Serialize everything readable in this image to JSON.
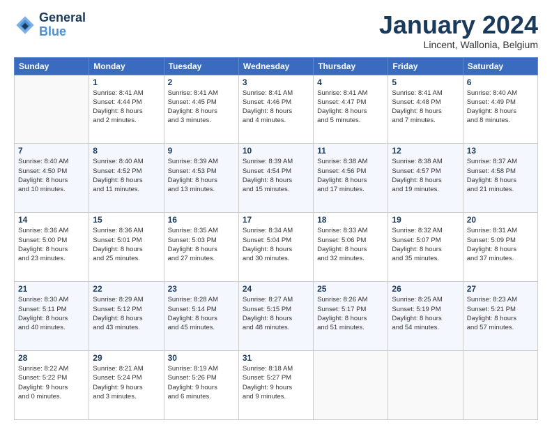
{
  "header": {
    "logo_line1": "General",
    "logo_line2": "Blue",
    "title": "January 2024",
    "subtitle": "Lincent, Wallonia, Belgium"
  },
  "days_of_week": [
    "Sunday",
    "Monday",
    "Tuesday",
    "Wednesday",
    "Thursday",
    "Friday",
    "Saturday"
  ],
  "weeks": [
    [
      {
        "day": "",
        "detail": ""
      },
      {
        "day": "1",
        "detail": "Sunrise: 8:41 AM\nSunset: 4:44 PM\nDaylight: 8 hours\nand 2 minutes."
      },
      {
        "day": "2",
        "detail": "Sunrise: 8:41 AM\nSunset: 4:45 PM\nDaylight: 8 hours\nand 3 minutes."
      },
      {
        "day": "3",
        "detail": "Sunrise: 8:41 AM\nSunset: 4:46 PM\nDaylight: 8 hours\nand 4 minutes."
      },
      {
        "day": "4",
        "detail": "Sunrise: 8:41 AM\nSunset: 4:47 PM\nDaylight: 8 hours\nand 5 minutes."
      },
      {
        "day": "5",
        "detail": "Sunrise: 8:41 AM\nSunset: 4:48 PM\nDaylight: 8 hours\nand 7 minutes."
      },
      {
        "day": "6",
        "detail": "Sunrise: 8:40 AM\nSunset: 4:49 PM\nDaylight: 8 hours\nand 8 minutes."
      }
    ],
    [
      {
        "day": "7",
        "detail": "Sunrise: 8:40 AM\nSunset: 4:50 PM\nDaylight: 8 hours\nand 10 minutes."
      },
      {
        "day": "8",
        "detail": "Sunrise: 8:40 AM\nSunset: 4:52 PM\nDaylight: 8 hours\nand 11 minutes."
      },
      {
        "day": "9",
        "detail": "Sunrise: 8:39 AM\nSunset: 4:53 PM\nDaylight: 8 hours\nand 13 minutes."
      },
      {
        "day": "10",
        "detail": "Sunrise: 8:39 AM\nSunset: 4:54 PM\nDaylight: 8 hours\nand 15 minutes."
      },
      {
        "day": "11",
        "detail": "Sunrise: 8:38 AM\nSunset: 4:56 PM\nDaylight: 8 hours\nand 17 minutes."
      },
      {
        "day": "12",
        "detail": "Sunrise: 8:38 AM\nSunset: 4:57 PM\nDaylight: 8 hours\nand 19 minutes."
      },
      {
        "day": "13",
        "detail": "Sunrise: 8:37 AM\nSunset: 4:58 PM\nDaylight: 8 hours\nand 21 minutes."
      }
    ],
    [
      {
        "day": "14",
        "detail": "Sunrise: 8:36 AM\nSunset: 5:00 PM\nDaylight: 8 hours\nand 23 minutes."
      },
      {
        "day": "15",
        "detail": "Sunrise: 8:36 AM\nSunset: 5:01 PM\nDaylight: 8 hours\nand 25 minutes."
      },
      {
        "day": "16",
        "detail": "Sunrise: 8:35 AM\nSunset: 5:03 PM\nDaylight: 8 hours\nand 27 minutes."
      },
      {
        "day": "17",
        "detail": "Sunrise: 8:34 AM\nSunset: 5:04 PM\nDaylight: 8 hours\nand 30 minutes."
      },
      {
        "day": "18",
        "detail": "Sunrise: 8:33 AM\nSunset: 5:06 PM\nDaylight: 8 hours\nand 32 minutes."
      },
      {
        "day": "19",
        "detail": "Sunrise: 8:32 AM\nSunset: 5:07 PM\nDaylight: 8 hours\nand 35 minutes."
      },
      {
        "day": "20",
        "detail": "Sunrise: 8:31 AM\nSunset: 5:09 PM\nDaylight: 8 hours\nand 37 minutes."
      }
    ],
    [
      {
        "day": "21",
        "detail": "Sunrise: 8:30 AM\nSunset: 5:11 PM\nDaylight: 8 hours\nand 40 minutes."
      },
      {
        "day": "22",
        "detail": "Sunrise: 8:29 AM\nSunset: 5:12 PM\nDaylight: 8 hours\nand 43 minutes."
      },
      {
        "day": "23",
        "detail": "Sunrise: 8:28 AM\nSunset: 5:14 PM\nDaylight: 8 hours\nand 45 minutes."
      },
      {
        "day": "24",
        "detail": "Sunrise: 8:27 AM\nSunset: 5:15 PM\nDaylight: 8 hours\nand 48 minutes."
      },
      {
        "day": "25",
        "detail": "Sunrise: 8:26 AM\nSunset: 5:17 PM\nDaylight: 8 hours\nand 51 minutes."
      },
      {
        "day": "26",
        "detail": "Sunrise: 8:25 AM\nSunset: 5:19 PM\nDaylight: 8 hours\nand 54 minutes."
      },
      {
        "day": "27",
        "detail": "Sunrise: 8:23 AM\nSunset: 5:21 PM\nDaylight: 8 hours\nand 57 minutes."
      }
    ],
    [
      {
        "day": "28",
        "detail": "Sunrise: 8:22 AM\nSunset: 5:22 PM\nDaylight: 9 hours\nand 0 minutes."
      },
      {
        "day": "29",
        "detail": "Sunrise: 8:21 AM\nSunset: 5:24 PM\nDaylight: 9 hours\nand 3 minutes."
      },
      {
        "day": "30",
        "detail": "Sunrise: 8:19 AM\nSunset: 5:26 PM\nDaylight: 9 hours\nand 6 minutes."
      },
      {
        "day": "31",
        "detail": "Sunrise: 8:18 AM\nSunset: 5:27 PM\nDaylight: 9 hours\nand 9 minutes."
      },
      {
        "day": "",
        "detail": ""
      },
      {
        "day": "",
        "detail": ""
      },
      {
        "day": "",
        "detail": ""
      }
    ]
  ]
}
